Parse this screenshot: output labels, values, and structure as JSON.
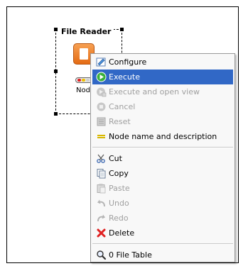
{
  "node": {
    "title": "File Reader",
    "label": "Nod"
  },
  "colors": {
    "selection": "#3168c6",
    "node_orange": "#e46b14",
    "delete_red": "#e02020"
  },
  "context_menu": {
    "items": [
      {
        "label": "Configure",
        "icon": "configure-icon",
        "enabled": true
      },
      {
        "label": "Execute",
        "icon": "execute-icon",
        "enabled": true,
        "selected": true
      },
      {
        "label": "Execute and open view",
        "icon": "execute-open-view-icon",
        "enabled": false
      },
      {
        "label": "Cancel",
        "icon": "cancel-icon",
        "enabled": false
      },
      {
        "label": "Reset",
        "icon": "reset-icon",
        "enabled": false
      },
      {
        "label": "Node name and description",
        "icon": "node-name-icon",
        "enabled": true
      },
      {
        "label": "Cut",
        "icon": "cut-icon",
        "enabled": true
      },
      {
        "label": "Copy",
        "icon": "copy-icon",
        "enabled": true
      },
      {
        "label": "Paste",
        "icon": "paste-icon",
        "enabled": false
      },
      {
        "label": "Undo",
        "icon": "undo-icon",
        "enabled": false
      },
      {
        "label": "Redo",
        "icon": "redo-icon",
        "enabled": false
      },
      {
        "label": "Delete",
        "icon": "delete-icon",
        "enabled": true
      },
      {
        "label": "0 File Table",
        "icon": "magnifier-icon",
        "enabled": true
      }
    ]
  }
}
